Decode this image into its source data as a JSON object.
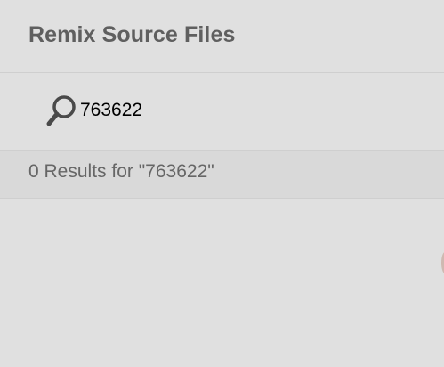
{
  "header": {
    "title": "Remix Source Files"
  },
  "search": {
    "value": "763622",
    "icon": "search-icon"
  },
  "results": {
    "summary": "0 Results for \"763622\""
  }
}
